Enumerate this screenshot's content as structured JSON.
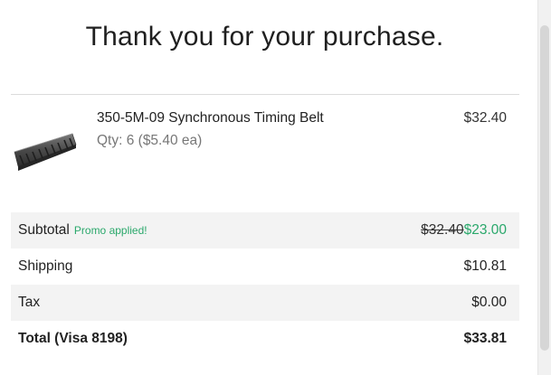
{
  "header": {
    "title": "Thank you for your purchase."
  },
  "product": {
    "image_icon": "timing-belt-image",
    "name": "350-5M-09 Synchronous Timing Belt",
    "qty_label": "Qty: 6 ($5.40 ea)",
    "price": "$32.40"
  },
  "summary": {
    "subtotal_label": "Subtotal",
    "promo_label": "Promo applied!",
    "subtotal_old": "$32.40",
    "subtotal_new": "$23.00",
    "shipping_label": "Shipping",
    "shipping_value": "$10.81",
    "tax_label": "Tax",
    "tax_value": "$0.00",
    "total_label": "Total (Visa 8198)",
    "total_value": "$33.81"
  },
  "colors": {
    "promo_green": "#2aa86b",
    "row_shade": "#f3f3f3",
    "divider": "#dcdcdc"
  }
}
